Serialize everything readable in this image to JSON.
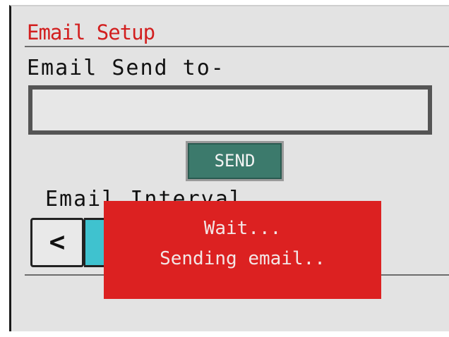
{
  "header": {
    "title": "Email Setup"
  },
  "email": {
    "send_to_label": "Email Send to-",
    "recipient_value": "",
    "send_button_label": "SEND"
  },
  "interval": {
    "label": "Email Interval",
    "prev_button_label": "<"
  },
  "toast": {
    "line1": "Wait...",
    "line2": "Sending email.."
  },
  "colors": {
    "title": "#d21f1f",
    "send_button": "#3c7a6c",
    "toast_background": "#dc2121",
    "interval_value": "#3fc2cf",
    "screen_background": "#e3e3e3"
  }
}
